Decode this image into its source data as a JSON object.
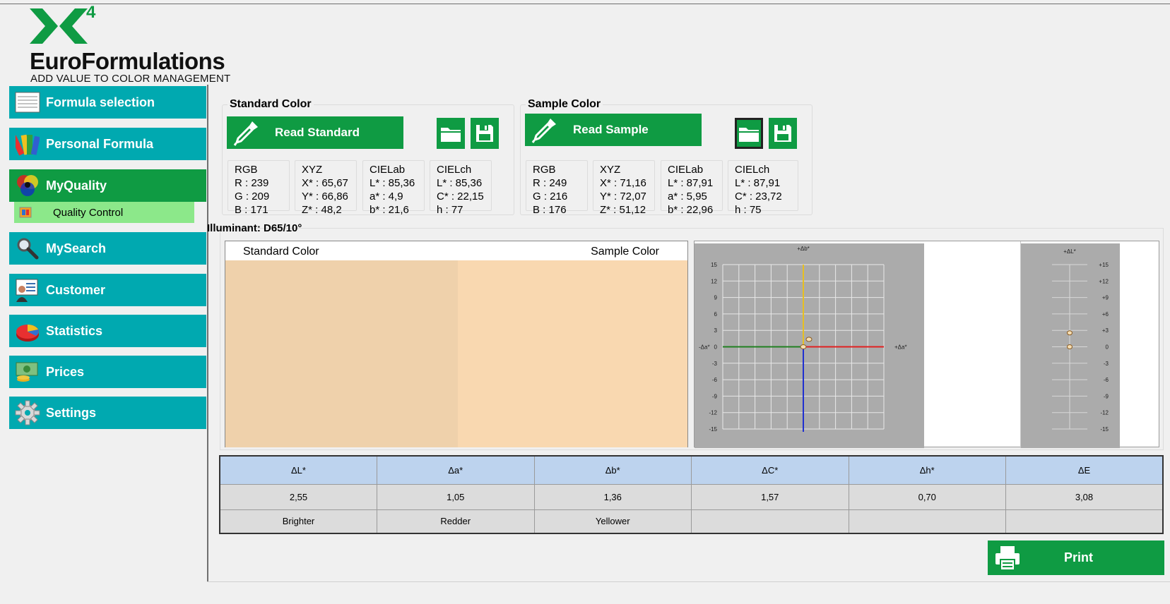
{
  "brand": {
    "superscript": "4",
    "name": "EuroFormulations",
    "tagline": "ADD VALUE TO COLOR MANAGEMENT",
    "green": "#0f9b43",
    "teal": "#00a9b0"
  },
  "sidebar": {
    "items": [
      {
        "label": "Formula selection",
        "icon": "formula-list-icon"
      },
      {
        "label": "Personal Formula",
        "icon": "color-fan-icon"
      },
      {
        "label": "MyQuality",
        "icon": "color-circles-icon"
      },
      {
        "label": "MySearch",
        "icon": "magnifier-icon"
      },
      {
        "label": "Customer",
        "icon": "customer-card-icon"
      },
      {
        "label": "Statistics",
        "icon": "pie-chart-icon"
      },
      {
        "label": "Prices",
        "icon": "money-icon"
      },
      {
        "label": "Settings",
        "icon": "gear-icon"
      }
    ],
    "sub_item": {
      "label": "Quality Control",
      "icon": "quality-control-icon"
    }
  },
  "standard": {
    "title": "Standard Color",
    "read_label": "Read Standard",
    "rgb": {
      "title": "RGB",
      "r": "R : 239",
      "g": "G : 209",
      "b": "B : 171"
    },
    "xyz": {
      "title": "XYZ",
      "x": "X* : 65,67",
      "y": "Y* : 66,86",
      "z": "Z* : 48,2"
    },
    "lab": {
      "title": "CIELab",
      "l": "L* : 85,36",
      "a": "a* : 4,9",
      "b": "b* : 21,6"
    },
    "lch": {
      "title": "CIELch",
      "l": "L* : 85,36",
      "c": "C* : 22,15",
      "h": "h : 77"
    },
    "color": "#efd1ab"
  },
  "sample": {
    "title": "Sample Color",
    "read_label": "Read Sample",
    "rgb": {
      "title": "RGB",
      "r": "R : 249",
      "g": "G : 216",
      "b": "B : 176"
    },
    "xyz": {
      "title": "XYZ",
      "x": "X* : 71,16",
      "y": "Y* : 72,07",
      "z": "Z* : 51,12"
    },
    "lab": {
      "title": "CIELab",
      "l": "L* : 87,91",
      "a": "a* : 5,95",
      "b": "b* : 22,96"
    },
    "lch": {
      "title": "CIELch",
      "l": "L* : 87,91",
      "c": "C* : 23,72",
      "h": "h : 75"
    },
    "color": "#f9d8b0"
  },
  "illuminant": {
    "title": "Illuminant: D65/10°",
    "standard_label": "Standard Color",
    "sample_label": "Sample Color"
  },
  "chart_data": [
    {
      "type": "scatter",
      "xlabel_pos": "+Δa*",
      "xlabel_neg": "-Δa*",
      "ylabel": "+Δb*",
      "xlim": [
        -15,
        15
      ],
      "ylim": [
        -15,
        15
      ],
      "ticks": [
        "15",
        "12",
        "9",
        "6",
        "3",
        "0",
        "-3",
        "-6",
        "-9",
        "-12",
        "-15"
      ],
      "grid": true,
      "points": [
        {
          "x": 0,
          "y": 0
        },
        {
          "x": 1.05,
          "y": 1.36
        }
      ],
      "axis_colors": {
        "pos_a": "#e02020",
        "neg_a": "#208020",
        "pos_b": "#e8c020",
        "neg_b": "#2030d0"
      }
    },
    {
      "type": "scatter",
      "ylabel": "+ΔL*",
      "ylim": [
        -15,
        15
      ],
      "ticks": [
        "+15",
        "+12",
        "+9",
        "+6",
        "+3",
        "0",
        "-3",
        "-6",
        "-9",
        "-12",
        "-15"
      ],
      "points": [
        {
          "x": 0,
          "y": 0
        },
        {
          "x": 0,
          "y": 2.55
        }
      ]
    }
  ],
  "table": {
    "headers": [
      "ΔL*",
      "Δa*",
      "Δb*",
      "ΔC*",
      "Δh*",
      "ΔE"
    ],
    "values": [
      "2,55",
      "1,05",
      "1,36",
      "1,57",
      "0,70",
      "3,08"
    ],
    "verdicts": [
      "Brighter",
      "Redder",
      "Yellower",
      "",
      "",
      ""
    ]
  },
  "print_label": "Print"
}
